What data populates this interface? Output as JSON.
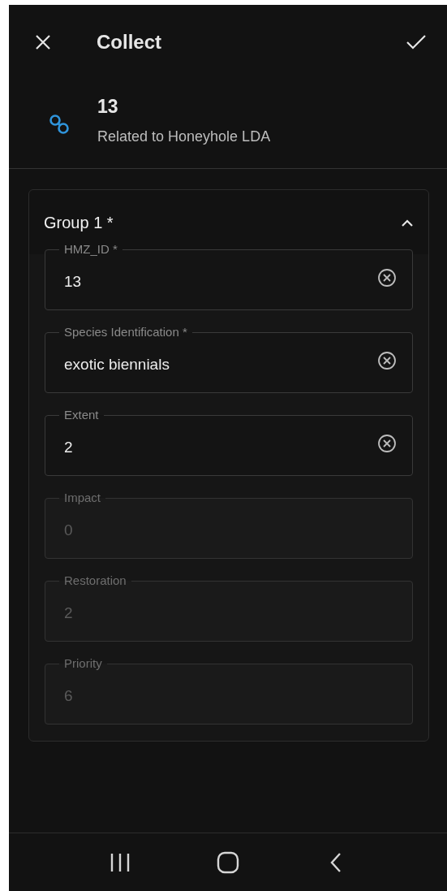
{
  "app_bar": {
    "title": "Collect"
  },
  "record": {
    "title": "13",
    "subtitle": "Related to Honeyhole LDA"
  },
  "group": {
    "title": "Group 1 *",
    "expanded": true,
    "fields": [
      {
        "label": "HMZ_ID *",
        "value": "13",
        "disabled": false
      },
      {
        "label": "Species Identification *",
        "value": "exotic biennials",
        "disabled": false
      },
      {
        "label": "Extent",
        "value": "2",
        "disabled": false
      },
      {
        "label": "Impact",
        "value": "0",
        "disabled": true
      },
      {
        "label": "Restoration",
        "value": "2",
        "disabled": true
      },
      {
        "label": "Priority",
        "value": "6",
        "disabled": true
      }
    ]
  }
}
